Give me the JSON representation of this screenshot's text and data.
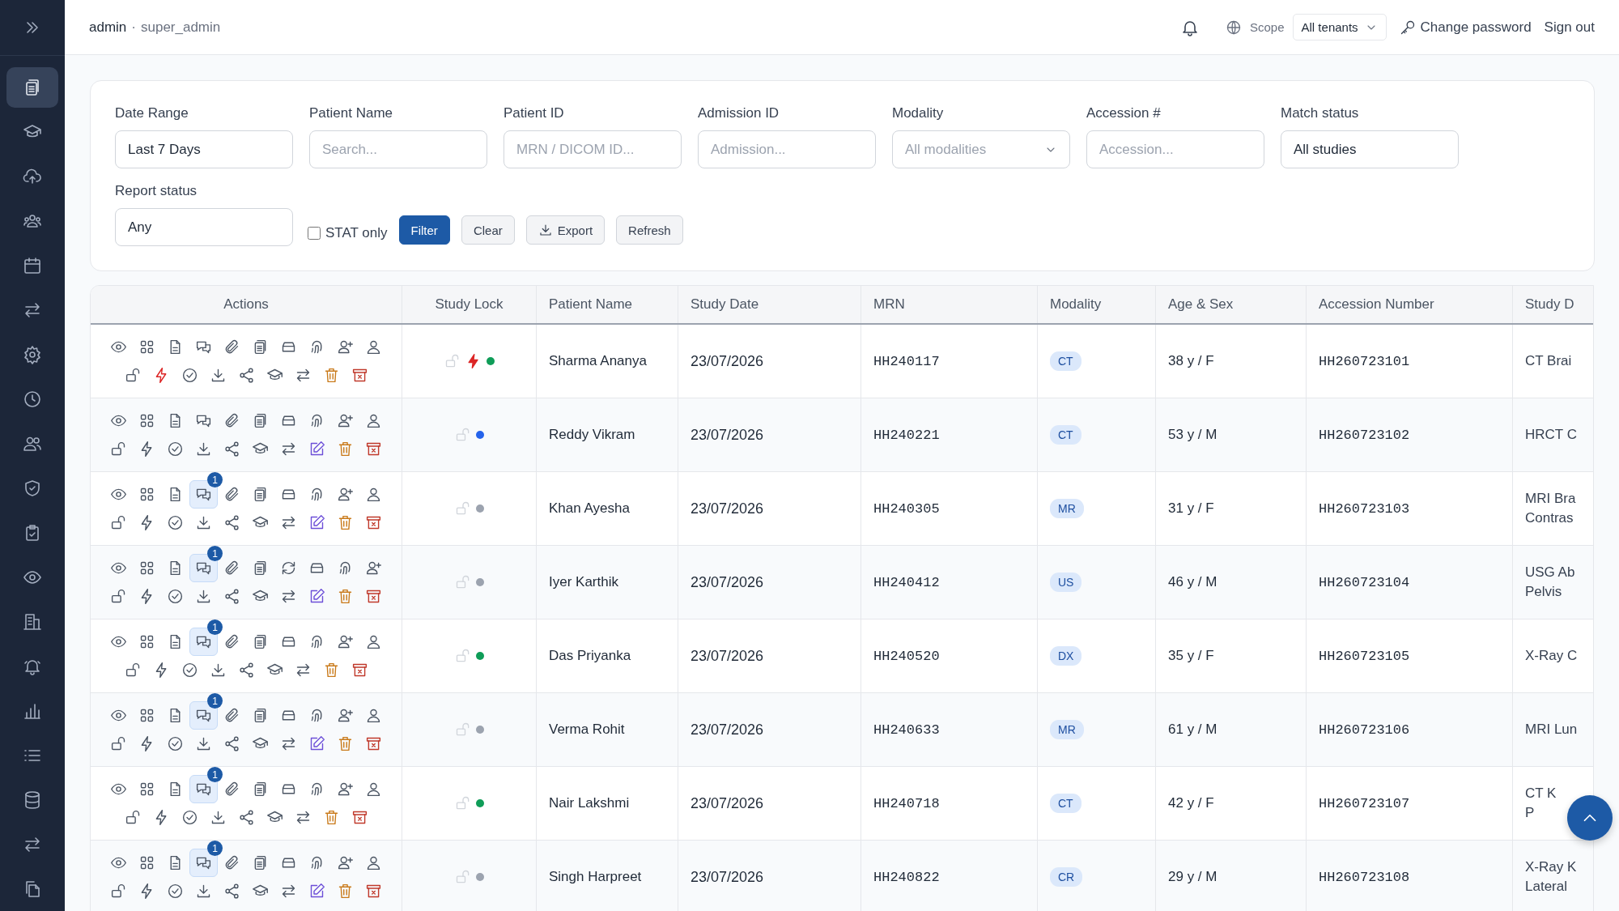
{
  "sidebar": {
    "items": [
      {
        "kind": "clipboard",
        "selected": true
      },
      {
        "kind": "cap",
        "selected": false
      },
      {
        "kind": "cloud-upload",
        "selected": false
      },
      {
        "kind": "users",
        "selected": false
      },
      {
        "kind": "calendar",
        "selected": false
      },
      {
        "kind": "swap",
        "selected": false
      },
      {
        "kind": "gear",
        "selected": false
      },
      {
        "kind": "clock",
        "selected": false
      },
      {
        "kind": "user-group",
        "selected": false
      },
      {
        "kind": "shield",
        "selected": false
      },
      {
        "kind": "clipboard-check",
        "selected": false
      },
      {
        "kind": "eye",
        "selected": false
      },
      {
        "kind": "building",
        "selected": false
      },
      {
        "kind": "bell-ring",
        "selected": false
      },
      {
        "kind": "bar-chart",
        "selected": false
      },
      {
        "kind": "list",
        "selected": false
      },
      {
        "kind": "database",
        "selected": false
      },
      {
        "kind": "swap",
        "selected": false
      },
      {
        "kind": "files",
        "selected": false
      }
    ]
  },
  "top_bar": {
    "user": "admin",
    "separator": "·",
    "role": "super_admin",
    "scope_label": "Scope",
    "scope_value": "All tenants",
    "change_password": "Change password",
    "sign_out": "Sign out"
  },
  "filters": {
    "fields": [
      {
        "label": "Date Range",
        "kind": "input",
        "value": "Last 7 Days"
      },
      {
        "label": "Patient Name",
        "kind": "input",
        "placeholder": "Search..."
      },
      {
        "label": "Patient ID",
        "kind": "input",
        "placeholder": "MRN / DICOM ID..."
      },
      {
        "label": "Admission ID",
        "kind": "input",
        "placeholder": "Admission..."
      },
      {
        "label": "Modality",
        "kind": "select",
        "placeholder": "All modalities"
      },
      {
        "label": "Accession #",
        "kind": "input",
        "placeholder": "Accession..."
      },
      {
        "label": "Match status",
        "kind": "input",
        "value": "All studies"
      },
      {
        "label": "Report status",
        "kind": "input",
        "value": "Any"
      }
    ],
    "stat_only": {
      "label": "STAT only",
      "checked": false
    },
    "buttons": [
      {
        "label": "Filter",
        "kind": "primary"
      },
      {
        "label": "Clear",
        "kind": "plain"
      },
      {
        "label": "Export",
        "kind": "download"
      },
      {
        "label": "Refresh",
        "kind": "plain"
      }
    ]
  },
  "table": {
    "columns": [
      "Actions",
      "Study Lock",
      "Patient Name",
      "Study Date",
      "MRN",
      "Modality",
      "Age & Sex",
      "Accession Number",
      "Study D"
    ],
    "rows": [
      {
        "stat": true,
        "color": "#0f9d58",
        "patient_name": "Sharma Ananya",
        "study_date": "23/07/2026",
        "mrn": "HH240117",
        "modality": "CT",
        "age_sex": "38 y / F",
        "accession": "HH260723101",
        "description": [
          "CT Brai"
        ],
        "actions": [
          {
            "kind": "view"
          },
          {
            "kind": "grid"
          },
          {
            "kind": "document"
          },
          {
            "kind": "chat"
          },
          {
            "kind": "attach"
          },
          {
            "kind": "clipboard"
          },
          {
            "kind": "tray"
          },
          {
            "kind": "fingerprint"
          },
          {
            "kind": "user-plus"
          },
          {
            "kind": "user"
          },
          {
            "kind": "lock"
          },
          {
            "kind": "stat"
          },
          {
            "kind": "check"
          },
          {
            "kind": "download"
          },
          {
            "kind": "share"
          },
          {
            "kind": "cap"
          },
          {
            "kind": "swap"
          },
          {
            "kind": "trash"
          },
          {
            "kind": "delete"
          }
        ]
      },
      {
        "stat": false,
        "color": "#2563eb",
        "patient_name": "Reddy Vikram",
        "study_date": "23/07/2026",
        "mrn": "HH240221",
        "modality": "CT",
        "age_sex": "53 y / M",
        "accession": "HH260723102",
        "description": [
          "HRCT C"
        ],
        "actions": [
          {
            "kind": "view"
          },
          {
            "kind": "grid"
          },
          {
            "kind": "document"
          },
          {
            "kind": "chat"
          },
          {
            "kind": "attach"
          },
          {
            "kind": "clipboard"
          },
          {
            "kind": "tray"
          },
          {
            "kind": "fingerprint"
          },
          {
            "kind": "user-plus"
          },
          {
            "kind": "user"
          },
          {
            "kind": "lock"
          },
          {
            "kind": "stat"
          },
          {
            "kind": "check"
          },
          {
            "kind": "download"
          },
          {
            "kind": "share"
          },
          {
            "kind": "cap"
          },
          {
            "kind": "swap"
          },
          {
            "kind": "edit"
          },
          {
            "kind": "trash"
          },
          {
            "kind": "delete"
          }
        ]
      },
      {
        "stat": false,
        "color": "#9ca3af",
        "patient_name": "Khan Ayesha",
        "study_date": "23/07/2026",
        "mrn": "HH240305",
        "modality": "MR",
        "age_sex": "31 y / F",
        "accession": "HH260723103",
        "description": [
          "MRI Bra",
          "Contras"
        ],
        "actions": [
          {
            "kind": "view"
          },
          {
            "kind": "grid"
          },
          {
            "kind": "document"
          },
          {
            "kind": "chat",
            "badge": "1"
          },
          {
            "kind": "attach"
          },
          {
            "kind": "clipboard"
          },
          {
            "kind": "tray"
          },
          {
            "kind": "fingerprint"
          },
          {
            "kind": "user-plus"
          },
          {
            "kind": "user"
          },
          {
            "kind": "lock"
          },
          {
            "kind": "stat"
          },
          {
            "kind": "check"
          },
          {
            "kind": "download"
          },
          {
            "kind": "share"
          },
          {
            "kind": "cap"
          },
          {
            "kind": "swap"
          },
          {
            "kind": "edit"
          },
          {
            "kind": "trash"
          },
          {
            "kind": "delete"
          }
        ]
      },
      {
        "stat": false,
        "color": "#9ca3af",
        "patient_name": "Iyer Karthik",
        "study_date": "23/07/2026",
        "mrn": "HH240412",
        "modality": "US",
        "age_sex": "46 y / M",
        "accession": "HH260723104",
        "description": [
          "USG Ab",
          "Pelvis"
        ],
        "actions": [
          {
            "kind": "view"
          },
          {
            "kind": "grid"
          },
          {
            "kind": "document"
          },
          {
            "kind": "chat",
            "badge": "1"
          },
          {
            "kind": "attach"
          },
          {
            "kind": "clipboard"
          },
          {
            "kind": "refresh"
          },
          {
            "kind": "tray"
          },
          {
            "kind": "fingerprint"
          },
          {
            "kind": "user-plus"
          },
          {
            "kind": "lock"
          },
          {
            "kind": "stat"
          },
          {
            "kind": "check"
          },
          {
            "kind": "download"
          },
          {
            "kind": "share"
          },
          {
            "kind": "cap"
          },
          {
            "kind": "swap"
          },
          {
            "kind": "edit"
          },
          {
            "kind": "trash"
          },
          {
            "kind": "delete"
          }
        ]
      },
      {
        "stat": false,
        "color": "#0f9d58",
        "patient_name": "Das Priyanka",
        "study_date": "23/07/2026",
        "mrn": "HH240520",
        "modality": "DX",
        "age_sex": "35 y / F",
        "accession": "HH260723105",
        "description": [
          "X-Ray C"
        ],
        "actions": [
          {
            "kind": "view"
          },
          {
            "kind": "grid"
          },
          {
            "kind": "document"
          },
          {
            "kind": "chat",
            "badge": "1"
          },
          {
            "kind": "attach"
          },
          {
            "kind": "clipboard"
          },
          {
            "kind": "tray"
          },
          {
            "kind": "fingerprint"
          },
          {
            "kind": "user-plus"
          },
          {
            "kind": "user"
          },
          {
            "kind": "lock"
          },
          {
            "kind": "stat"
          },
          {
            "kind": "check"
          },
          {
            "kind": "download"
          },
          {
            "kind": "share"
          },
          {
            "kind": "cap"
          },
          {
            "kind": "swap"
          },
          {
            "kind": "trash"
          },
          {
            "kind": "delete"
          }
        ]
      },
      {
        "stat": false,
        "color": "#9ca3af",
        "patient_name": "Verma Rohit",
        "study_date": "23/07/2026",
        "mrn": "HH240633",
        "modality": "MR",
        "age_sex": "61 y / M",
        "accession": "HH260723106",
        "description": [
          "MRI Lun"
        ],
        "actions": [
          {
            "kind": "view"
          },
          {
            "kind": "grid"
          },
          {
            "kind": "document"
          },
          {
            "kind": "chat",
            "badge": "1"
          },
          {
            "kind": "attach"
          },
          {
            "kind": "clipboard"
          },
          {
            "kind": "tray"
          },
          {
            "kind": "fingerprint"
          },
          {
            "kind": "user-plus"
          },
          {
            "kind": "user"
          },
          {
            "kind": "lock"
          },
          {
            "kind": "stat"
          },
          {
            "kind": "check"
          },
          {
            "kind": "download"
          },
          {
            "kind": "share"
          },
          {
            "kind": "cap"
          },
          {
            "kind": "swap"
          },
          {
            "kind": "edit"
          },
          {
            "kind": "trash"
          },
          {
            "kind": "delete"
          }
        ]
      },
      {
        "stat": false,
        "color": "#0f9d58",
        "patient_name": "Nair Lakshmi",
        "study_date": "23/07/2026",
        "mrn": "HH240718",
        "modality": "CT",
        "age_sex": "42 y / F",
        "accession": "HH260723107",
        "description": [
          "CT K",
          "P"
        ],
        "actions": [
          {
            "kind": "view"
          },
          {
            "kind": "grid"
          },
          {
            "kind": "document"
          },
          {
            "kind": "chat",
            "badge": "1"
          },
          {
            "kind": "attach"
          },
          {
            "kind": "clipboard"
          },
          {
            "kind": "tray"
          },
          {
            "kind": "fingerprint"
          },
          {
            "kind": "user-plus"
          },
          {
            "kind": "user"
          },
          {
            "kind": "lock"
          },
          {
            "kind": "stat"
          },
          {
            "kind": "check"
          },
          {
            "kind": "download"
          },
          {
            "kind": "share"
          },
          {
            "kind": "cap"
          },
          {
            "kind": "swap"
          },
          {
            "kind": "trash"
          },
          {
            "kind": "delete"
          }
        ]
      },
      {
        "stat": false,
        "color": "#9ca3af",
        "patient_name": "Singh Harpreet",
        "study_date": "23/07/2026",
        "mrn": "HH240822",
        "modality": "CR",
        "age_sex": "29 y / M",
        "accession": "HH260723108",
        "description": [
          "X-Ray K",
          "Lateral"
        ],
        "actions": [
          {
            "kind": "view"
          },
          {
            "kind": "grid"
          },
          {
            "kind": "document"
          },
          {
            "kind": "chat",
            "badge": "1"
          },
          {
            "kind": "attach"
          },
          {
            "kind": "clipboard"
          },
          {
            "kind": "tray"
          },
          {
            "kind": "fingerprint"
          },
          {
            "kind": "user-plus"
          },
          {
            "kind": "user"
          },
          {
            "kind": "lock"
          },
          {
            "kind": "stat"
          },
          {
            "kind": "check"
          },
          {
            "kind": "download"
          },
          {
            "kind": "share"
          },
          {
            "kind": "cap"
          },
          {
            "kind": "swap"
          },
          {
            "kind": "edit"
          },
          {
            "kind": "trash"
          },
          {
            "kind": "delete"
          }
        ]
      }
    ]
  }
}
